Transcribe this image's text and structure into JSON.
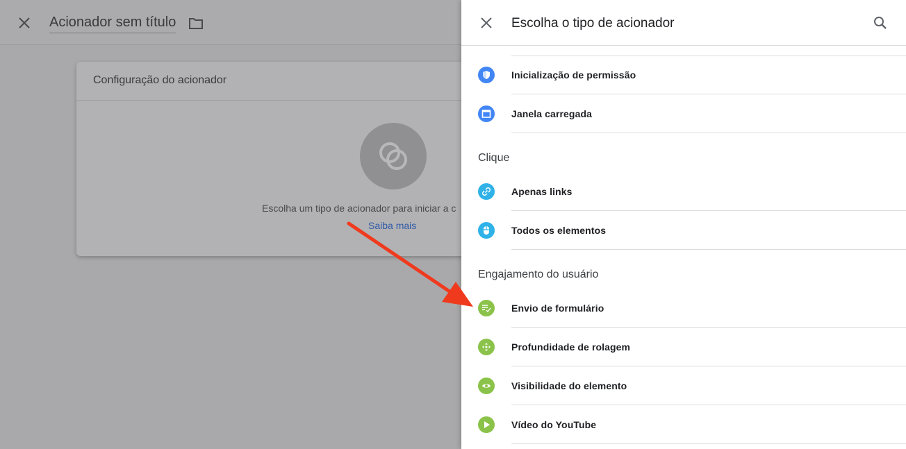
{
  "background": {
    "title": "Acionador sem título",
    "card": {
      "header": "Configuração do acionador",
      "message": "Escolha um tipo de acionador para iniciar a c",
      "link": "Saiba mais"
    }
  },
  "panel": {
    "title": "Escolha o tipo de acionador",
    "items_top": [
      {
        "label": "Inicialização de permissão",
        "icon": "shield-icon",
        "color": "#4285f4"
      },
      {
        "label": "Janela carregada",
        "icon": "window-icon",
        "color": "#4285f4"
      }
    ],
    "sections": [
      {
        "title": "Clique",
        "items": [
          {
            "label": "Apenas links",
            "icon": "link-icon",
            "color": "#2fb2e8"
          },
          {
            "label": "Todos os elementos",
            "icon": "mouse-icon",
            "color": "#2fb2e8"
          }
        ]
      },
      {
        "title": "Engajamento do usuário",
        "items": [
          {
            "label": "Envio de formulário",
            "icon": "form-submit-icon",
            "color": "#8bc34a"
          },
          {
            "label": "Profundidade de rolagem",
            "icon": "scroll-depth-icon",
            "color": "#8bc34a"
          },
          {
            "label": "Visibilidade do elemento",
            "icon": "eye-icon",
            "color": "#8bc34a"
          },
          {
            "label": "Vídeo do YouTube",
            "icon": "play-icon",
            "color": "#8bc34a"
          }
        ]
      }
    ]
  },
  "annotation": {
    "arrow_color": "#f03a1e"
  }
}
